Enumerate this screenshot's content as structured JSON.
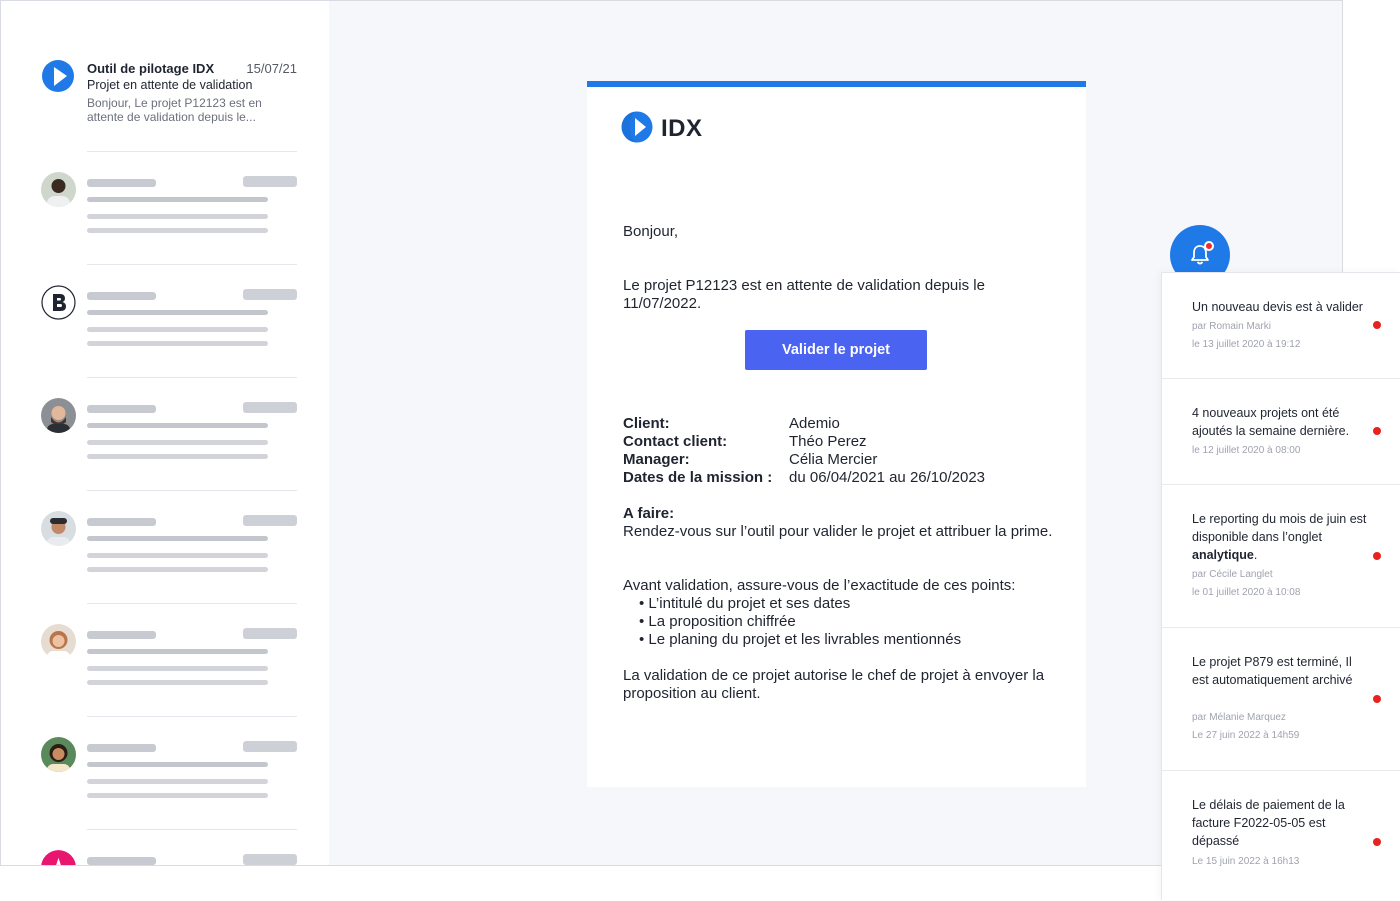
{
  "inbox": {
    "first": {
      "sender": "Outil de pilotage IDX",
      "date": "15/07/21",
      "subject": "Projet en attente de validation",
      "preview": "Bonjour, Le projet P12123 est en attente de validation depuis le..."
    },
    "avatars": [
      "person-avatar",
      "b-logo-avatar",
      "person-avatar",
      "person-avatar",
      "person-avatar",
      "person-avatar",
      "a-logo-avatar"
    ]
  },
  "email": {
    "brand": "IDX",
    "greeting": "Bonjour,",
    "intro": "Le projet P12123 est en attente de validation depuis le 11/07/2022.",
    "button": "Valider le projet",
    "details": [
      {
        "label": "Client:",
        "value": "Ademio"
      },
      {
        "label": "Contact client:",
        "value": "Théo Perez"
      },
      {
        "label": "Manager:",
        "value": "Célia Mercier"
      },
      {
        "label": "Dates de la mission :",
        "value": "du 06/04/2021 au 26/10/2023"
      }
    ],
    "todo_heading": "A faire:",
    "todo_text": "Rendez-vous sur l’outil pour valider le projet et attribuer la prime.",
    "before_heading": "Avant validation, assure-vous de l’exactitude de ces points:",
    "bullets": [
      "L’intitulé du projet et ses dates",
      "La proposition chiffrée",
      "Le planing du projet et les livrables mentionnés"
    ],
    "closing": "La validation de ce projet autorise le chef de projet à envoyer la proposition au client."
  },
  "notifications": [
    {
      "text": "Un nouveau devis est à valider",
      "by": "par Romain Marki",
      "date": "le 13 juillet 2020 à 19:12"
    },
    {
      "text": "4 nouveaux projets ont été ajoutés la semaine dernière.",
      "by": "",
      "date": "le 12 juillet 2020 à 08:00"
    },
    {
      "text_before": "Le reporting du mois de juin est disponible dans l’onglet ",
      "text_bold": "analytique",
      "text_after": ".",
      "by": "par Cécile Langlet",
      "date": "le 01 juillet 2020 à 10:08"
    },
    {
      "text": "Le projet P879 est terminé, Il est automatiquement archivé",
      "by": "par Mélanie Marquez",
      "date": "Le 27 juin 2022 à 14h59"
    },
    {
      "text": "Le délais de paiement de la facture F2022-05-05 est dépassé",
      "by": "",
      "date": "Le 15 juin 2022 à 16h13"
    }
  ],
  "colors": {
    "accent": "#1f7ae8",
    "button": "#4a63f0",
    "alert": "#e8221f"
  }
}
